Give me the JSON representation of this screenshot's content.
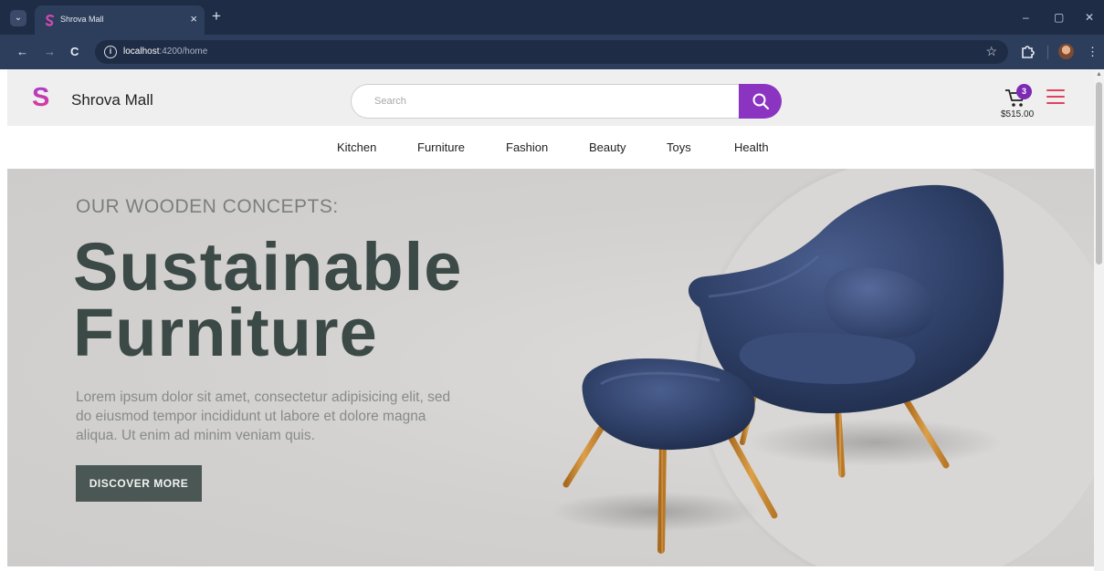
{
  "browser": {
    "tab_title": "Shrova Mall",
    "tab_close": "×",
    "new_tab": "+",
    "url_host": "localhost",
    "url_path": ":4200/home",
    "nav_back": "←",
    "nav_forward": "→",
    "nav_reload": "C",
    "star": "☆",
    "minimize": "–",
    "restore": "▢",
    "close": "✕",
    "menu": "⋮"
  },
  "header": {
    "logo_letter": "S",
    "brand_name": "Shrova Mall",
    "search_placeholder": "Search",
    "search_value": "",
    "cart_count": "3",
    "cart_total": "$515.00"
  },
  "categories": [
    {
      "label": "Kitchen"
    },
    {
      "label": "Furniture"
    },
    {
      "label": "Fashion"
    },
    {
      "label": "Beauty"
    },
    {
      "label": "Toys"
    },
    {
      "label": "Health"
    }
  ],
  "hero": {
    "kicker": "OUR WOODEN CONCEPTS:",
    "title_line1": "Sustainable",
    "title_line2": "Furniture",
    "description": "Lorem ipsum dolor sit amet, consectetur adipisicing elit, sed do eiusmod tempor incididunt ut labore et dolore magna aliqua. Ut enim ad minim veniam quis.",
    "cta_label": "DISCOVER MORE"
  },
  "colors": {
    "browser_frame": "#1f2c45",
    "browser_toolbar": "#2d3e5c",
    "accent_purple": "#8c34c2",
    "menu_red": "#e0435a",
    "hero_text": "#3c4a47",
    "cta_bg": "#4b5754",
    "chair_blue": "#2e3f66",
    "leg_wood": "#c8892f"
  }
}
